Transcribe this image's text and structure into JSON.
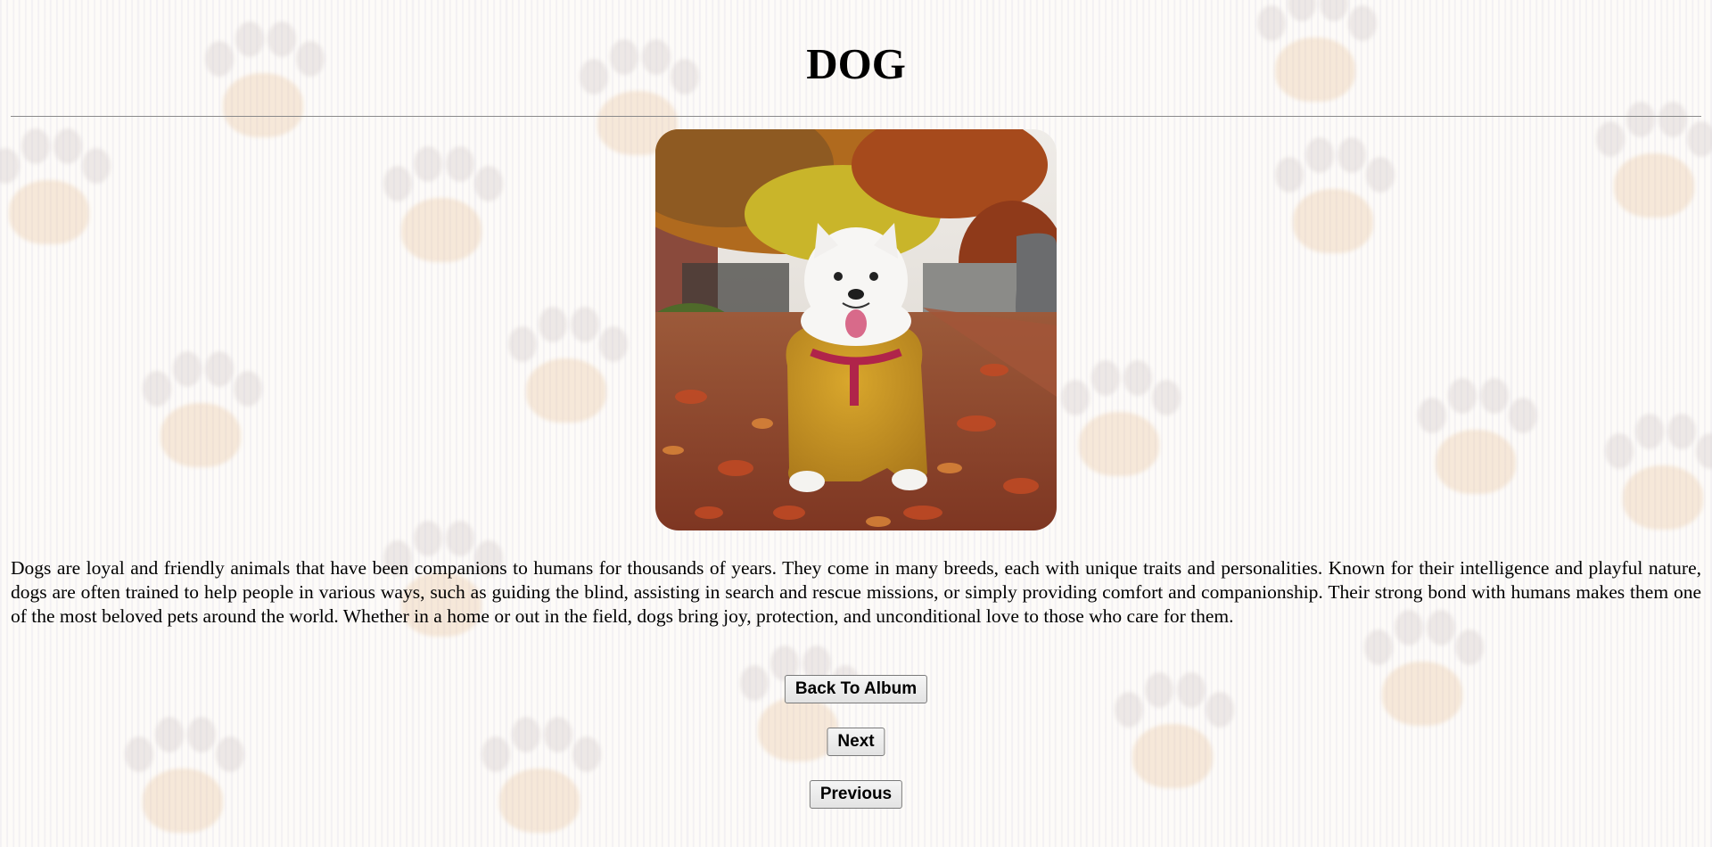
{
  "page": {
    "title": "DOG"
  },
  "photo": {
    "subject": "white samoyed dog in mustard raincoat on autumn leaves",
    "colors": {
      "sky": "#e9e6e2",
      "foliage": "#b8761f",
      "leaves": "#a5492a",
      "coat": "#c8921c",
      "dog": "#f7f6f4"
    }
  },
  "description": "Dogs are loyal and friendly animals that have been companions to humans for thousands of years. They come in many breeds, each with unique traits and personalities. Known for their intelligence and playful nature, dogs are often trained to help people in various ways, such as guiding the blind, assisting in search and rescue missions, or simply providing comfort and companionship. Their strong bond with humans makes them one of the most beloved pets around the world. Whether in a home or out in the field, dogs bring joy, protection, and unconditional love to those who care for them.",
  "buttons": {
    "back_label": "Back To Album",
    "next_label": "Next",
    "previous_label": "Previous"
  },
  "background": {
    "pattern": "paw-print-icon",
    "base_color": "#fdfbf8",
    "paw_color": "#e8c4a0"
  }
}
